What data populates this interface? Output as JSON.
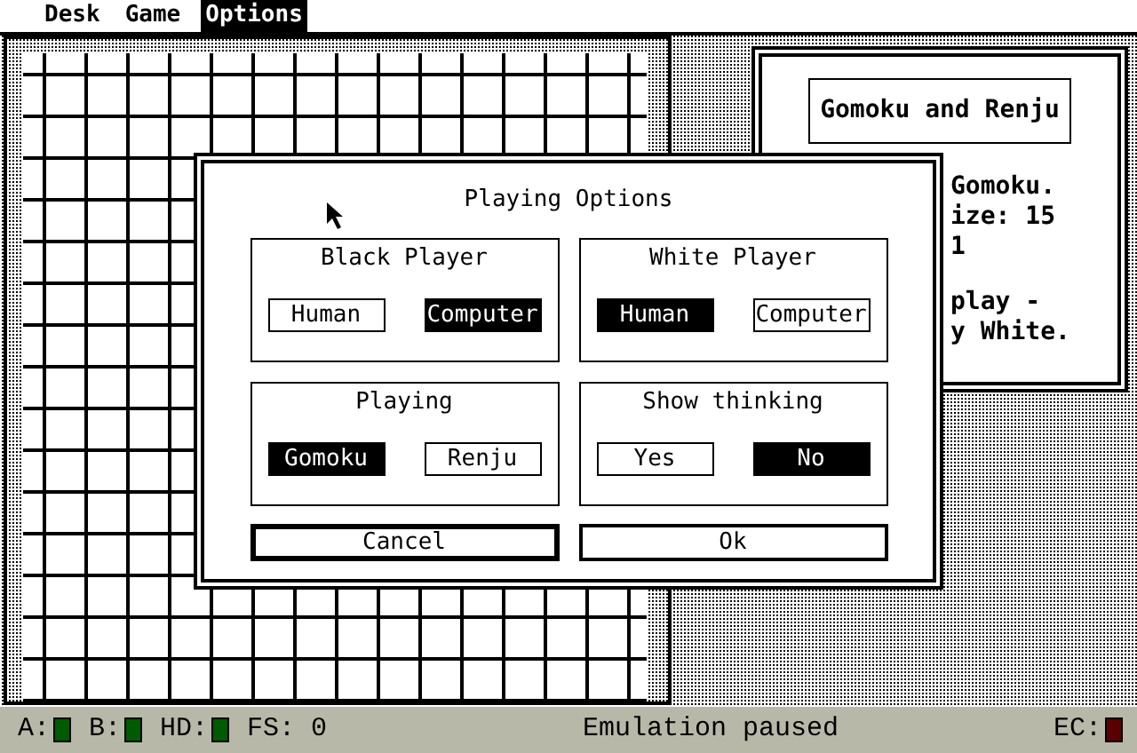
{
  "menu_bar": [
    {
      "label": "Desk",
      "selected": false
    },
    {
      "label": "Game",
      "selected": false
    },
    {
      "label": "Options",
      "selected": true
    }
  ],
  "info_window": {
    "title": "Gomoku and Renju",
    "paragraphs": [
      [
        "Gomoku.",
        "ize: 15",
        "1"
      ],
      [
        "play -",
        "y White."
      ]
    ]
  },
  "dialog": {
    "title": "Playing Options",
    "groups": [
      {
        "title": "Black Player",
        "options": [
          {
            "label": "Human",
            "selected": false
          },
          {
            "label": "Computer",
            "selected": true
          }
        ]
      },
      {
        "title": "White Player",
        "options": [
          {
            "label": "Human",
            "selected": true
          },
          {
            "label": "Computer",
            "selected": false
          }
        ]
      },
      {
        "title": "Playing",
        "options": [
          {
            "label": "Gomoku",
            "selected": true
          },
          {
            "label": "Renju",
            "selected": false
          }
        ]
      },
      {
        "title": "Show thinking",
        "options": [
          {
            "label": "Yes",
            "selected": false
          },
          {
            "label": "No",
            "selected": true
          }
        ]
      }
    ],
    "buttons": [
      {
        "label": "Cancel",
        "default": true
      },
      {
        "label": "Ok",
        "default": false
      }
    ]
  },
  "status_bar": {
    "drives": [
      {
        "label": "A:",
        "color": "#005a00"
      },
      {
        "label": "B:",
        "color": "#005a00"
      },
      {
        "label": "HD:",
        "color": "#005a00"
      }
    ],
    "fs": "FS: 0",
    "message": "Emulation paused",
    "indicator": {
      "label": "EC:",
      "color": "#5a0000"
    }
  }
}
